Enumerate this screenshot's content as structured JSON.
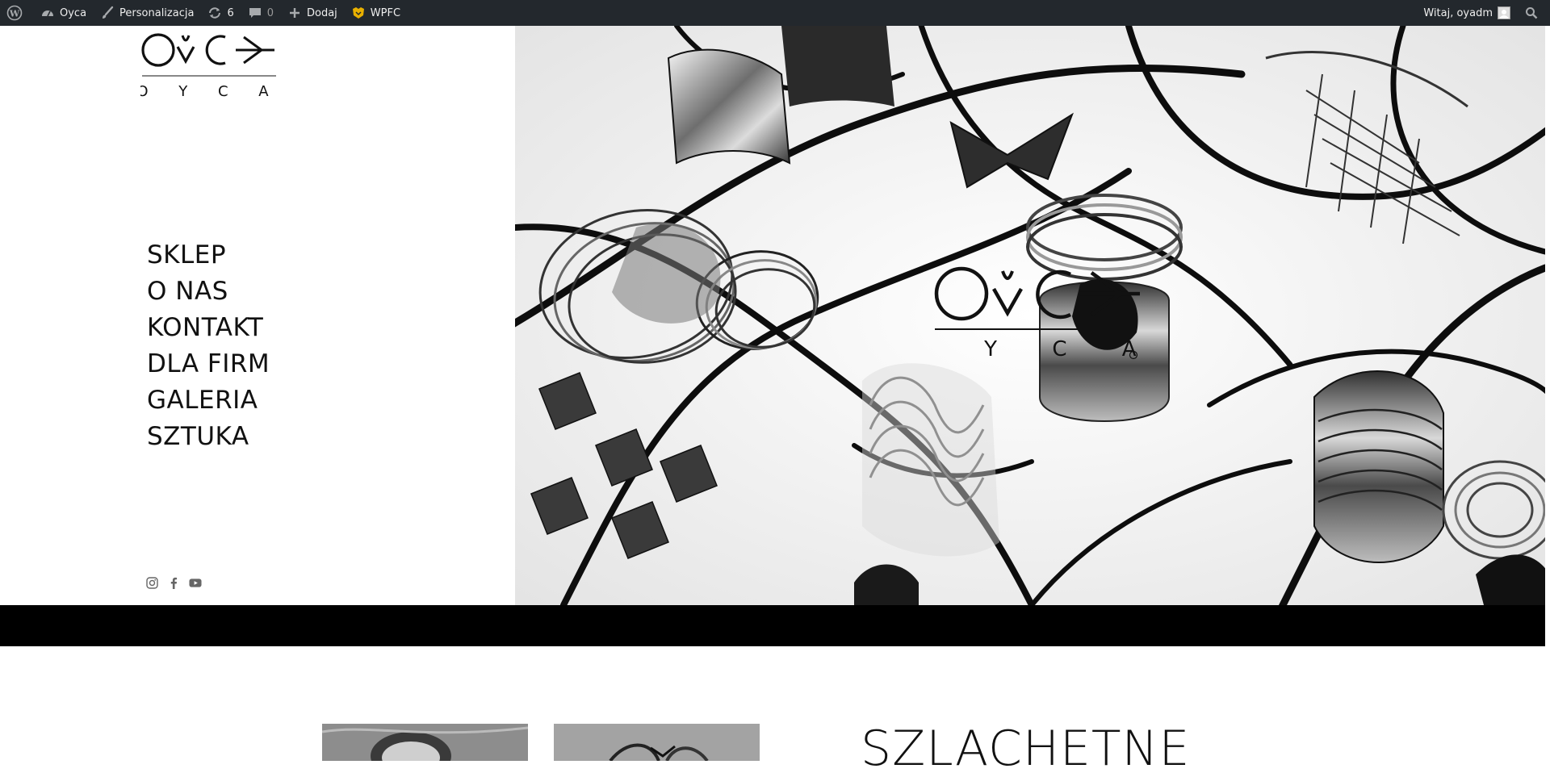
{
  "admin_bar": {
    "site_name": "Oyca",
    "customize_label": "Personalizacja",
    "updates_count": "6",
    "comments_count": "0",
    "add_new_label": "Dodaj",
    "wpfc_label": "WPFC",
    "greeting": "Witaj, oyadm",
    "icons": [
      "wordpress-icon",
      "dashboard-icon",
      "brush-icon",
      "updates-icon",
      "comments-icon",
      "plus-icon",
      "wpfc-icon",
      "search-icon"
    ]
  },
  "brand": {
    "logo_mark_text": "OYCA",
    "logo_sub_text": "O Y C A"
  },
  "nav": {
    "items": [
      {
        "label": "SKLEP"
      },
      {
        "label": "O NAS"
      },
      {
        "label": "KONTAKT"
      },
      {
        "label": "DLA FIRM"
      },
      {
        "label": "GALERIA"
      },
      {
        "label": "SZTUKA"
      }
    ]
  },
  "social": [
    "instagram-icon",
    "facebook-icon",
    "youtube-icon"
  ],
  "hero": {
    "description": "hero-jewelry-photo"
  },
  "section": {
    "title": "SZLACHETNE"
  },
  "colors": {
    "admin_bar_bg": "#23282d",
    "band": "#000000",
    "text": "#111111"
  }
}
